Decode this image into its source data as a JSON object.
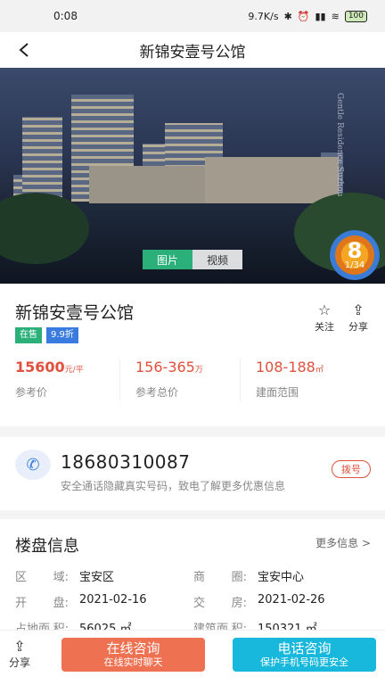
{
  "status_bar": {
    "time": "0:08",
    "speed": "9.7K/s",
    "battery": "100"
  },
  "header": {
    "back_icon": "chevron-left-icon",
    "title": "新锦安壹号公馆"
  },
  "hero": {
    "watermark": "Gentle Residence Suzhou",
    "tabs": [
      {
        "label": "图片",
        "active": true
      },
      {
        "label": "视频",
        "active": false
      }
    ],
    "count_big": "8",
    "count_small": "1/34"
  },
  "project": {
    "name": "新锦安壹号公馆",
    "tags": [
      {
        "label": "在售",
        "color": "#2bb07a"
      },
      {
        "label": "9.9折",
        "color": "#3a7be0"
      }
    ],
    "follow_label": "关注",
    "share_label": "分享",
    "stats": [
      {
        "value": "15600",
        "unit": "元/平",
        "label": "参考价"
      },
      {
        "value": "156-365",
        "unit": "万",
        "label": "参考总价"
      },
      {
        "value": "108-188",
        "unit": "㎡",
        "label": "建面范围"
      }
    ]
  },
  "contact": {
    "phone": "18680310087",
    "description": "安全通话隐藏真实号码，致电了解更多优惠信息",
    "dial_label": "拨号"
  },
  "details": {
    "title": "楼盘信息",
    "more_label": "更多信息 >",
    "rows": [
      [
        {
          "key": "区",
          "key2": "域:",
          "value": "宝安区"
        },
        {
          "key": "商",
          "key2": "圈:",
          "value": "宝安中心"
        }
      ],
      [
        {
          "key": "开",
          "key2": "盘:",
          "value": "2021-02-16"
        },
        {
          "key": "交",
          "key2": "房:",
          "value": "2021-02-26"
        }
      ],
      [
        {
          "key": "占地面",
          "key2": "积:",
          "value": "56025 ㎡"
        },
        {
          "key": "建筑面",
          "key2": "积:",
          "value": "150321 ㎡"
        }
      ]
    ]
  },
  "bottom_bar": {
    "share_label": "分享",
    "online": {
      "main": "在线咨询",
      "sub": "在线实时聊天"
    },
    "phone": {
      "main": "电话咨询",
      "sub": "保护手机号码更安全"
    }
  }
}
